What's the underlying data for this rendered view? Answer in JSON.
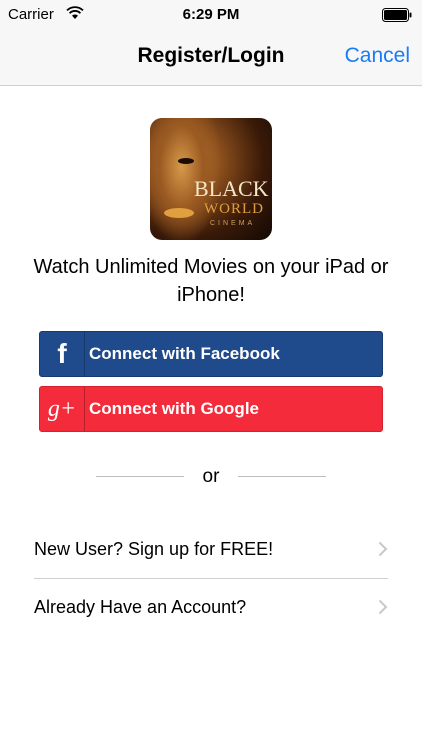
{
  "status_bar": {
    "carrier": "Carrier",
    "time": "6:29 PM"
  },
  "nav": {
    "title": "Register/Login",
    "cancel": "Cancel"
  },
  "logo": {
    "line1": "BLACK",
    "line2": "WORLD",
    "line3": "CINEMA"
  },
  "tagline": "Watch Unlimited Movies on your iPad or iPhone!",
  "buttons": {
    "facebook": {
      "label": "Connect with Facebook",
      "icon": "facebook-f-icon",
      "color": "#1f4a8c"
    },
    "google": {
      "label": "Connect with Google",
      "icon": "google-plus-icon",
      "color": "#f42b3a"
    }
  },
  "separator": "or",
  "list": [
    {
      "label": "New User? Sign up for FREE!",
      "icon": "chevron-right-icon"
    },
    {
      "label": "Already Have an Account?",
      "icon": "chevron-right-icon"
    }
  ],
  "colors": {
    "accent": "#1a7cf5"
  }
}
